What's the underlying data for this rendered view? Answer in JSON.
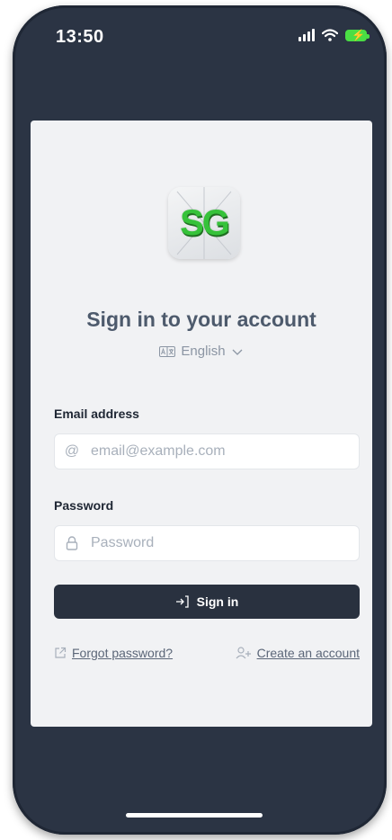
{
  "status_bar": {
    "time": "13:50"
  },
  "logo": {
    "text": "SG",
    "color": "#36c23a"
  },
  "header": {
    "title": "Sign in to your account",
    "language": "English"
  },
  "form": {
    "email_label": "Email address",
    "email_placeholder": "email@example.com",
    "password_label": "Password",
    "password_placeholder": "Password",
    "submit_label": "Sign in"
  },
  "links": {
    "forgot_password": "Forgot password?",
    "create_account": "Create an account"
  },
  "icons": {
    "language": "translate-icon",
    "language_dropdown": "chevron-down-icon",
    "email": "at-icon",
    "password": "lock-icon",
    "submit": "sign-in-icon",
    "forgot": "external-link-icon",
    "create": "user-plus-icon"
  },
  "colors": {
    "phone_frame": "#2b3444",
    "card": "#f1f2f4",
    "button": "#29313f",
    "battery": "#4ade44"
  }
}
